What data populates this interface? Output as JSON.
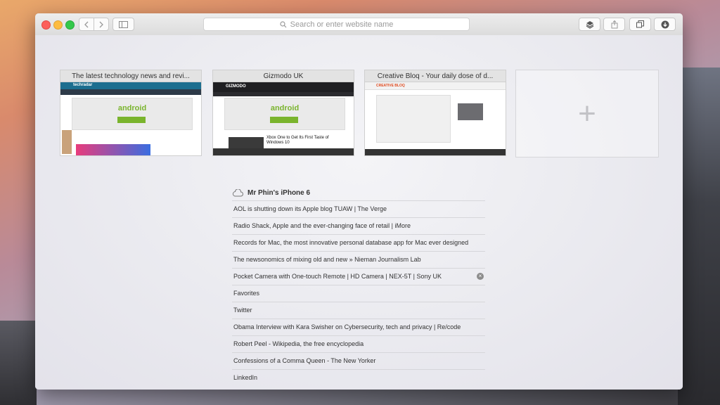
{
  "toolbar": {
    "back_icon": "chevron-left-icon",
    "forward_icon": "chevron-right-icon",
    "sidebar_icon": "sidebar-icon",
    "search_placeholder": "Search or enter website name",
    "layers_icon": "layers-icon",
    "share_icon": "share-icon",
    "tabs_icon": "tabs-icon",
    "download_icon": "download-icon"
  },
  "top_sites": [
    {
      "title": "The latest technology news and revi...",
      "logo_text": "techradar",
      "bar_color": "#1c6e8f",
      "ad_text": "android"
    },
    {
      "title": "Gizmodo UK",
      "logo_text": "GIZMODO",
      "bar_color": "#1f1f22",
      "ad_text": "android",
      "headline": "Xbox One to Get Its First Taste of Windows 10"
    },
    {
      "title": "Creative Bloq - Your daily dose of d...",
      "logo_text": "CREATIVE BLOQ",
      "bar_color": "#f2f2f2"
    }
  ],
  "add_tile": {
    "symbol": "+"
  },
  "icloud": {
    "device_name": "Mr Phin's iPhone 6",
    "tabs": [
      "AOL is shutting down its Apple blog TUAW | The Verge",
      "Radio Shack, Apple and the ever-changing face of retail | iMore",
      "Records for Mac, the most innovative personal database app for Mac ever designed",
      "The newsonomics of mixing old and new » Nieman Journalism Lab",
      "Pocket Camera with One-touch Remote | HD Camera | NEX-5T | Sony UK",
      "Favorites",
      "Twitter",
      "Obama Interview with Kara Swisher on Cybersecurity, tech and privacy | Re/code",
      "Robert Peel - Wikipedia, the free encyclopedia",
      "Confessions of a Comma Queen - The New Yorker",
      "LinkedIn"
    ],
    "close_symbol": "×"
  }
}
